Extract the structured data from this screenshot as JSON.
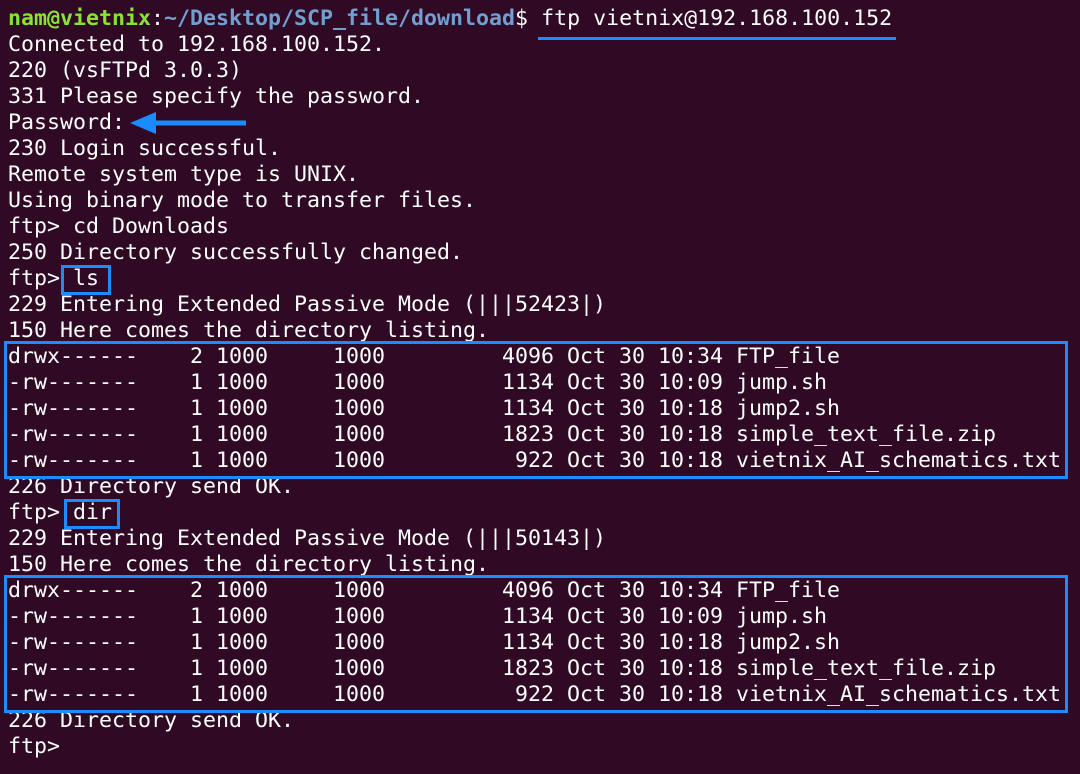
{
  "prompt": {
    "user_host": "nam@vietnix",
    "separator": ":",
    "path": "~/Desktop/SCP_file/download",
    "symbol": "$ ",
    "command": "ftp vietnix@192.168.100.152"
  },
  "session_lines": [
    "Connected to 192.168.100.152.",
    "220 (vsFTPd 3.0.3)",
    "331 Please specify the password.",
    "Password:",
    "230 Login successful.",
    "Remote system type is UNIX.",
    "Using binary mode to transfer files.",
    "ftp> cd Downloads",
    "250 Directory successfully changed."
  ],
  "ls_block": {
    "prompt": "ftp> ",
    "command": "ls",
    "pre_lines": [
      "229 Entering Extended Passive Mode (|||52423|)",
      "150 Here comes the directory listing."
    ],
    "listing": [
      "drwx------    2 1000     1000         4096 Oct 30 10:34 FTP_file",
      "-rw-------    1 1000     1000         1134 Oct 30 10:09 jump.sh",
      "-rw-------    1 1000     1000         1134 Oct 30 10:18 jump2.sh",
      "-rw-------    1 1000     1000         1823 Oct 30 10:18 simple_text_file.zip",
      "-rw-------    1 1000     1000          922 Oct 30 10:18 vietnix_AI_schematics.txt"
    ],
    "post_line": "226 Directory send OK."
  },
  "dir_block": {
    "prompt": "ftp> ",
    "command": "dir",
    "pre_lines": [
      "229 Entering Extended Passive Mode (|||50143|)",
      "150 Here comes the directory listing."
    ],
    "listing": [
      "drwx------    2 1000     1000         4096 Oct 30 10:34 FTP_file",
      "-rw-------    1 1000     1000         1134 Oct 30 10:09 jump.sh",
      "-rw-------    1 1000     1000         1134 Oct 30 10:18 jump2.sh",
      "-rw-------    1 1000     1000         1823 Oct 30 10:18 simple_text_file.zip",
      "-rw-------    1 1000     1000          922 Oct 30 10:18 vietnix_AI_schematics.txt"
    ],
    "post_line": "226 Directory send OK."
  },
  "final_prompt": "ftp> ",
  "colors": {
    "background": "#300a24",
    "text": "#ffffff",
    "user_host": "#8ae234",
    "path": "#729fcf",
    "annotation": "#1a8cff"
  },
  "annotations": {
    "arrow_icon": "left-arrow-icon"
  }
}
